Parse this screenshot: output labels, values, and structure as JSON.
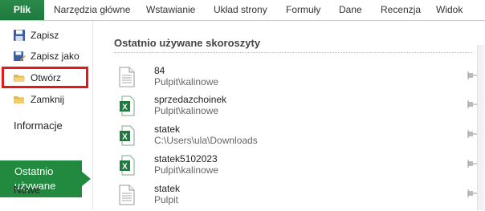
{
  "ribbon": {
    "tabs": [
      "Plik",
      "Narzędzia główne",
      "Wstawianie",
      "Układ strony",
      "Formuły",
      "Dane",
      "Recenzja",
      "Widok"
    ]
  },
  "sidebar": {
    "commands": [
      {
        "label": "Zapisz",
        "icon": "save-icon"
      },
      {
        "label": "Zapisz jako",
        "icon": "save-as-icon"
      },
      {
        "label": "Otwórz",
        "icon": "open-folder-icon"
      },
      {
        "label": "Zamknij",
        "icon": "close-folder-icon"
      }
    ],
    "info_label": "Informacje",
    "recent_label_line1": "Ostatnio",
    "recent_label_line2": "używane",
    "new_label": "Nowe"
  },
  "main": {
    "title": "Ostatnio używane skoroszyty",
    "recent": [
      {
        "name": "84",
        "path": "Pulpit\\kalinowe",
        "icon": "text-file-icon"
      },
      {
        "name": "sprzedazchoinek",
        "path": "Pulpit\\kalinowe",
        "icon": "excel-file-icon"
      },
      {
        "name": "statek",
        "path": "C:\\Users\\ula\\Downloads",
        "icon": "excel-file-icon"
      },
      {
        "name": "statek5102023",
        "path": "Pulpit\\kalinowe",
        "icon": "excel-file-icon"
      },
      {
        "name": "statek",
        "path": "Pulpit",
        "icon": "text-file-icon"
      }
    ]
  },
  "colors": {
    "accent": "#218a3e",
    "highlight": "#e0191d"
  }
}
